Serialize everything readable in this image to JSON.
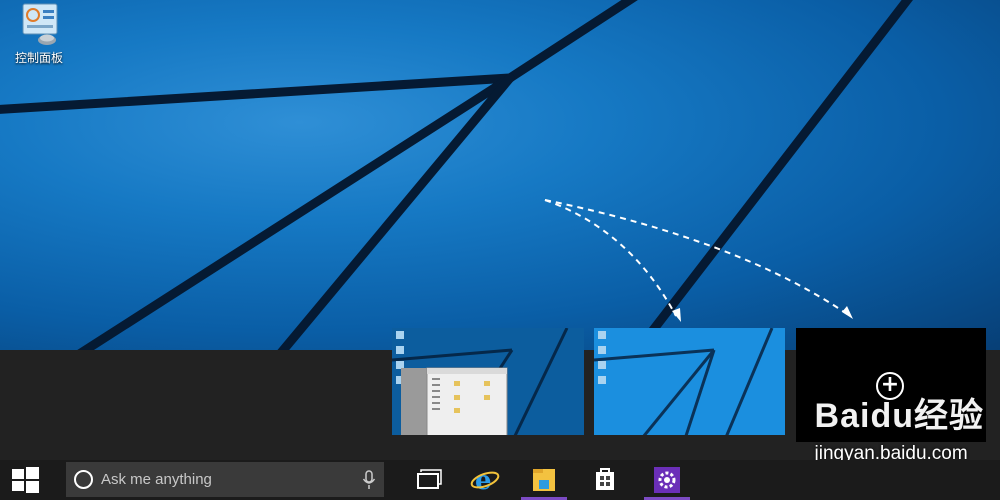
{
  "desktop": {
    "icons": [
      {
        "label": "控制面板",
        "icon": "control-panel-icon"
      }
    ]
  },
  "taskbar": {
    "start_icon": "windows-logo-icon",
    "search": {
      "placeholder": "Ask me anything",
      "icon": "cortana-circle-icon",
      "mic_icon": "microphone-icon"
    },
    "pinned": [
      {
        "name": "task-view",
        "icon": "task-view-icon"
      },
      {
        "name": "internet-explorer",
        "icon": "ie-icon"
      },
      {
        "name": "file-explorer",
        "icon": "folder-icon"
      },
      {
        "name": "store",
        "icon": "store-icon"
      },
      {
        "name": "settings",
        "icon": "gear-icon"
      }
    ]
  },
  "task_view": {
    "desktops": [
      "desktop-1-thumbnail",
      "desktop-2-thumbnail"
    ],
    "add_desktop_icon": "plus-circle-icon"
  },
  "watermark": {
    "brand": "Baidu经验",
    "site": "jingyan.baidu.com"
  },
  "colors": {
    "taskbar": "#1b1b1b",
    "task_view_strip": "#222222",
    "search_box": "#3a3a3a",
    "active_indicator": "#7c4bc4",
    "wallpaper": "#0b5fa5"
  }
}
